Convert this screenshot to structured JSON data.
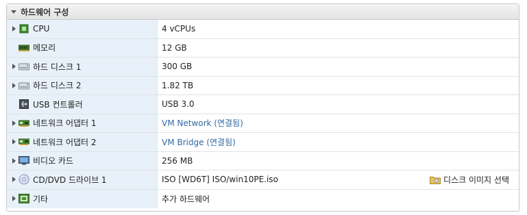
{
  "section": {
    "title": "하드웨어 구성"
  },
  "rows": [
    {
      "label": "CPU",
      "value": "4 vCPUs",
      "icon": "cpu-icon",
      "expandable": true
    },
    {
      "label": "메모리",
      "value": "12 GB",
      "icon": "memory-icon",
      "expandable": false
    },
    {
      "label": "하드 디스크 1",
      "value": "300 GB",
      "icon": "hard-disk-icon",
      "expandable": true
    },
    {
      "label": "하드 디스크 2",
      "value": "1.82 TB",
      "icon": "hard-disk-icon",
      "expandable": true
    },
    {
      "label": "USB 컨트롤러",
      "value": "USB 3.0",
      "icon": "usb-icon",
      "expandable": false
    },
    {
      "label": "네트워크 어댑터 1",
      "value": "VM Network (연결됨)",
      "icon": "network-adapter-icon",
      "expandable": true,
      "link": true
    },
    {
      "label": "네트워크 어댑터 2",
      "value": "VM Bridge (연결됨)",
      "icon": "network-adapter-icon",
      "expandable": true,
      "link": true
    },
    {
      "label": "비디오 카드",
      "value": "256 MB",
      "icon": "video-card-icon",
      "expandable": true
    },
    {
      "label": "CD/DVD 드라이브 1",
      "value": "ISO [WD6T] ISO/win10PE.iso",
      "icon": "cd-dvd-icon",
      "expandable": true,
      "action": "디스크 이미지 선택",
      "action_icon": "folder-icon"
    },
    {
      "label": "기타",
      "value": "추가 하드웨어",
      "icon": "other-hardware-icon",
      "expandable": true
    }
  ],
  "colors": {
    "label_bg": "#e8f1f9",
    "link": "#2f6aa3",
    "header_bg": "#e9e9e9"
  }
}
